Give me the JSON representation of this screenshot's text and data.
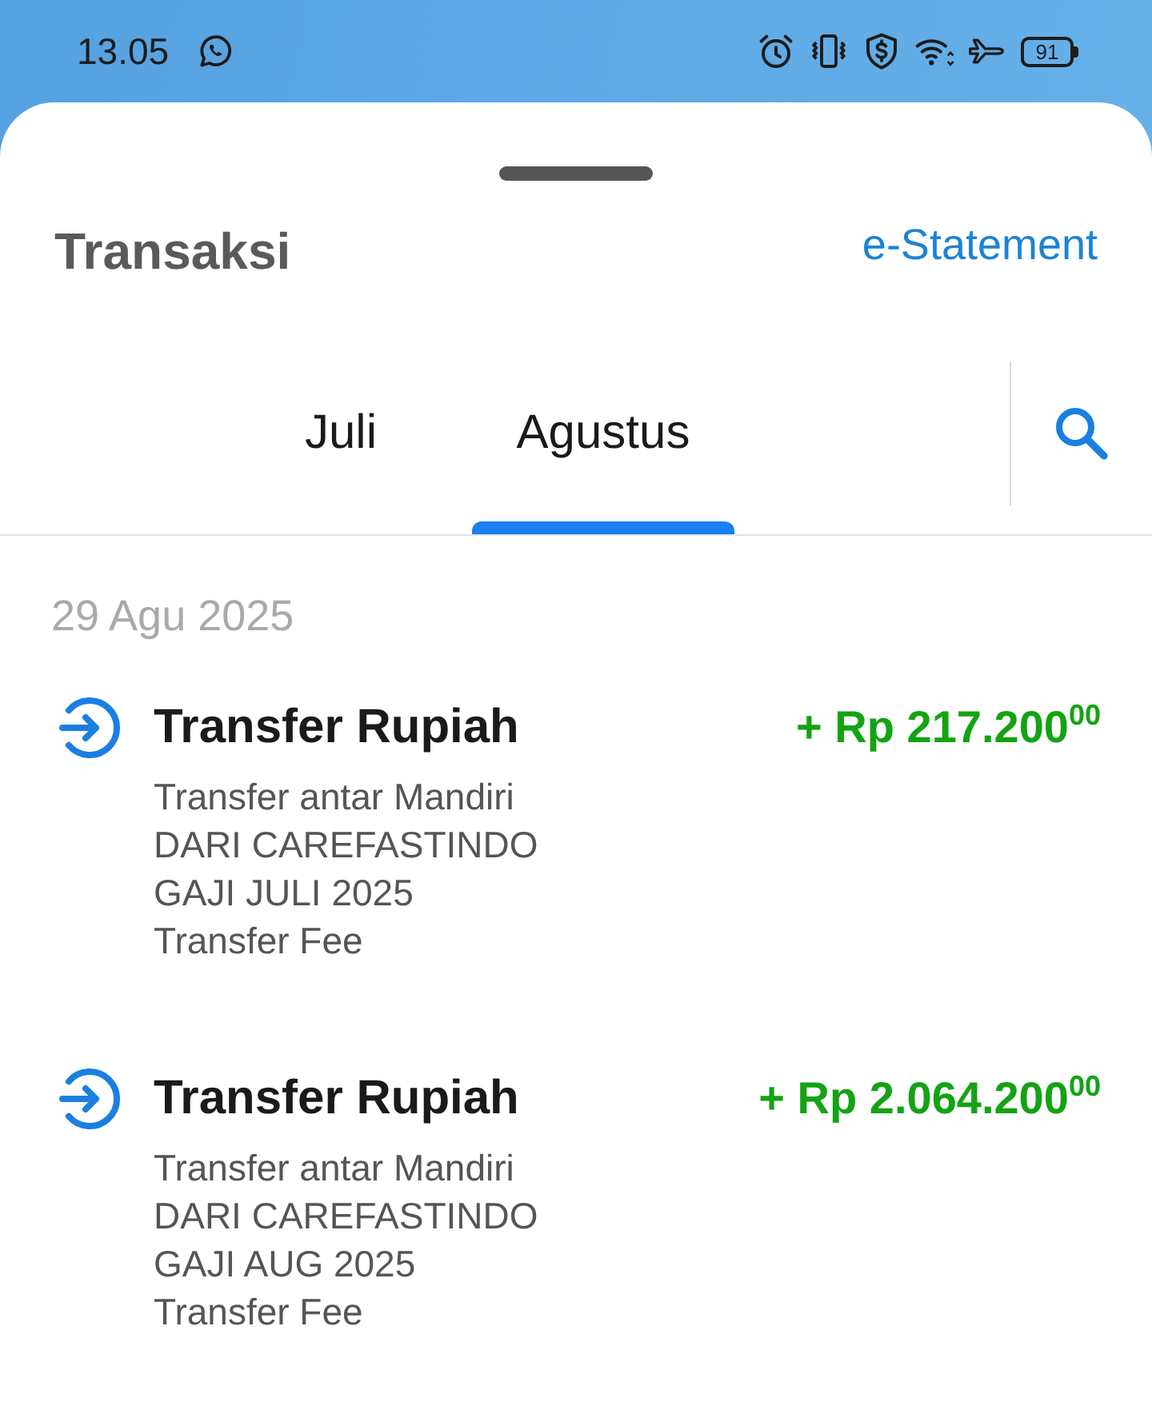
{
  "status_bar": {
    "time": "13.05",
    "battery": "91"
  },
  "header": {
    "title": "Transaksi",
    "link": "e-Statement"
  },
  "tabs": [
    {
      "label": "Juli",
      "selected": false
    },
    {
      "label": "Agustus",
      "selected": true
    }
  ],
  "sections": [
    {
      "date": "29 Agu 2025",
      "transactions": [
        {
          "kind": "incoming",
          "title": "Transfer Rupiah",
          "amount": "+ Rp 217.200$^{00}$",
          "details": [
            "Transfer antar Mandiri",
            "DARI CAREFASTINDO",
            "GAJI JULI 2025",
            "Transfer Fee"
          ]
        },
        {
          "kind": "incoming",
          "title": "Transfer Rupiah",
          "amount": "+ Rp 2.064.200$^{00}$",
          "details": [
            "Transfer antar Mandiri",
            "DARI CAREFASTINDO",
            "GAJI AUG 2025",
            "Transfer Fee"
          ]
        }
      ]
    }
  ]
}
